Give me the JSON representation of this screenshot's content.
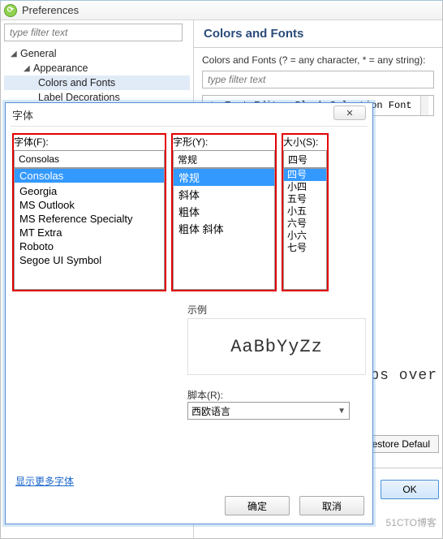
{
  "pref": {
    "title": "Preferences",
    "filter_placeholder": "type filter text",
    "tree": {
      "general": "General",
      "appearance": "Appearance",
      "colors_fonts": "Colors and Fonts",
      "label_decorations": "Label Decorations"
    },
    "right": {
      "heading": "Colors and Fonts",
      "desc": "Colors and Fonts (? = any character, * = any string):",
      "filter_placeholder": "type filter text",
      "aa": "Aa",
      "selected_font": "Text Editor Block Selection Font",
      "sample_line": "umps  over",
      "restore": "Restore Defaul",
      "ok": "OK"
    }
  },
  "fd": {
    "title": "字体",
    "faint1": "",
    "faint2": "",
    "close_x": "✕",
    "font_label": "字体(F):",
    "font_value": "Consolas",
    "font_list": [
      "Consolas",
      "",
      "Georgia",
      "MS Outlook",
      "MS Reference Specialty",
      "MT Extra",
      "Roboto",
      "Segoe UI Symbol"
    ],
    "style_label": "字形(Y):",
    "style_value": "常规",
    "style_list": [
      "常规",
      "斜体",
      "粗体",
      "粗体 斜体"
    ],
    "size_label": "大小(S):",
    "size_value": "四号",
    "size_list": [
      "四号",
      "小四",
      "五号",
      "小五",
      "六号",
      "小六",
      "七号"
    ],
    "sample_label": "示例",
    "sample_text": "AaBbYyZz",
    "script_label": "脚本(R):",
    "script_value": "西欧语言",
    "more_fonts": "显示更多字体",
    "ok": "确定",
    "cancel": "取消"
  },
  "watermark": "51CTO博客"
}
